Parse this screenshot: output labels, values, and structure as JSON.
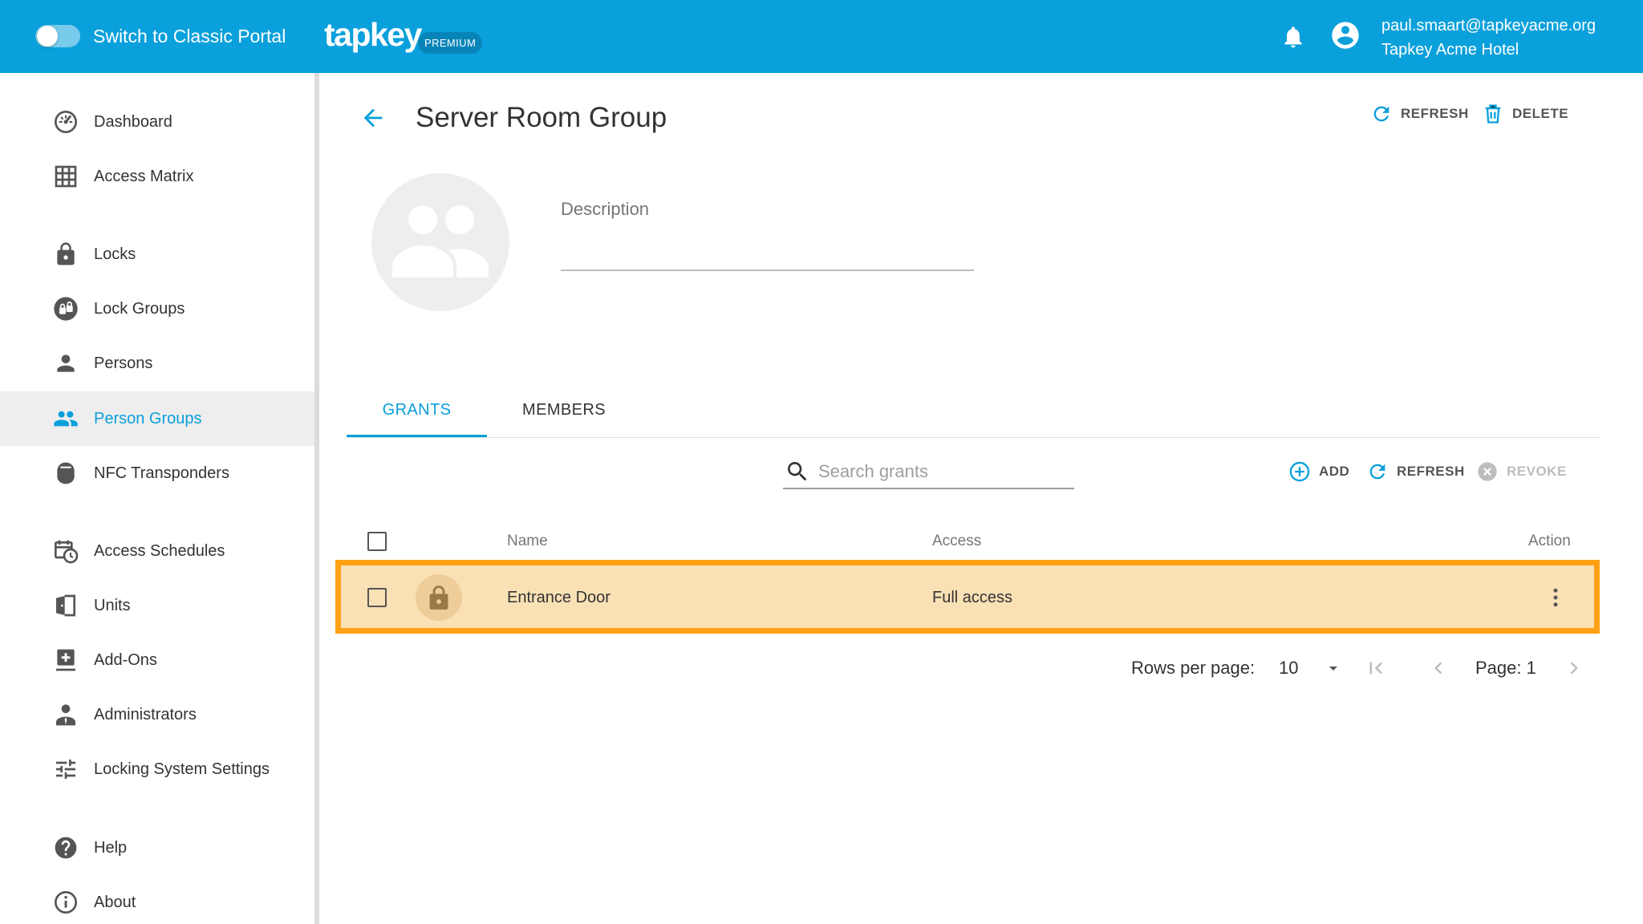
{
  "header": {
    "switch_label": "Switch to Classic Portal",
    "logo": "tapkey",
    "badge": "PREMIUM",
    "user_email": "paul.smaart@tapkeyacme.org",
    "user_org": "Tapkey Acme Hotel"
  },
  "sidebar": {
    "items": [
      {
        "label": "Dashboard",
        "icon": "dashboard-icon"
      },
      {
        "label": "Access Matrix",
        "icon": "grid-icon"
      },
      {
        "label": "Locks",
        "icon": "lock-icon"
      },
      {
        "label": "Lock Groups",
        "icon": "lock-group-icon"
      },
      {
        "label": "Persons",
        "icon": "person-icon"
      },
      {
        "label": "Person Groups",
        "icon": "people-icon",
        "active": true
      },
      {
        "label": "NFC Transponders",
        "icon": "transponder-icon"
      },
      {
        "label": "Access Schedules",
        "icon": "calendar-clock-icon"
      },
      {
        "label": "Units",
        "icon": "door-icon"
      },
      {
        "label": "Add-Ons",
        "icon": "add-box-icon"
      },
      {
        "label": "Administrators",
        "icon": "admin-icon"
      },
      {
        "label": "Locking System Settings",
        "icon": "sliders-icon"
      },
      {
        "label": "Help",
        "icon": "help-icon"
      },
      {
        "label": "About",
        "icon": "info-icon"
      }
    ]
  },
  "main": {
    "title": "Server Room Group",
    "refresh_label": "REFRESH",
    "delete_label": "DELETE",
    "description_label": "Description",
    "description_value": "",
    "tabs": [
      {
        "label": "GRANTS",
        "active": true
      },
      {
        "label": "MEMBERS",
        "active": false
      }
    ],
    "search_placeholder": "Search grants",
    "toolbar": {
      "add_label": "ADD",
      "refresh_label": "REFRESH",
      "revoke_label": "REVOKE"
    },
    "table": {
      "columns": [
        "Name",
        "Access",
        "Action"
      ],
      "rows": [
        {
          "name": "Entrance Door",
          "access": "Full access",
          "icon": "lock-icon"
        }
      ]
    },
    "pagination": {
      "rows_per_page_label": "Rows per page:",
      "rows_per_page": "10",
      "page_label": "Page: 1"
    }
  },
  "colors": {
    "brand": "#0aa0db",
    "highlight_border": "#ffa114",
    "highlight_fill": "#fae1b5",
    "disabled": "#bdbdbd"
  }
}
